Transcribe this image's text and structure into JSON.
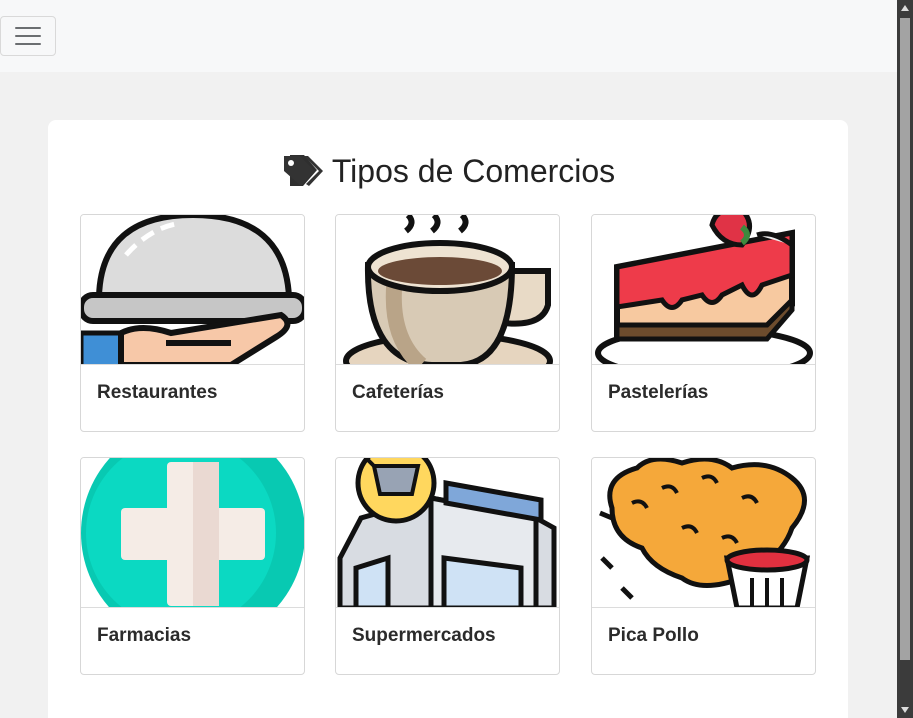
{
  "navbar": {
    "toggle_icon": "hamburger-icon"
  },
  "page": {
    "title": "Tipos de Comercios",
    "title_icon": "tags-icon"
  },
  "categories": [
    {
      "label": "Restaurantes",
      "icon": "cloche-serving-icon"
    },
    {
      "label": "Cafeterías",
      "icon": "coffee-cup-icon"
    },
    {
      "label": "Pastelerías",
      "icon": "cake-slice-icon"
    },
    {
      "label": "Farmacias",
      "icon": "pharmacy-cross-icon"
    },
    {
      "label": "Supermercados",
      "icon": "supermarket-icon"
    },
    {
      "label": "Pica Pollo",
      "icon": "fried-chicken-icon"
    }
  ],
  "colors": {
    "background": "#f1f1f1",
    "card": "#ffffff",
    "navbar": "#f7f8f9"
  }
}
